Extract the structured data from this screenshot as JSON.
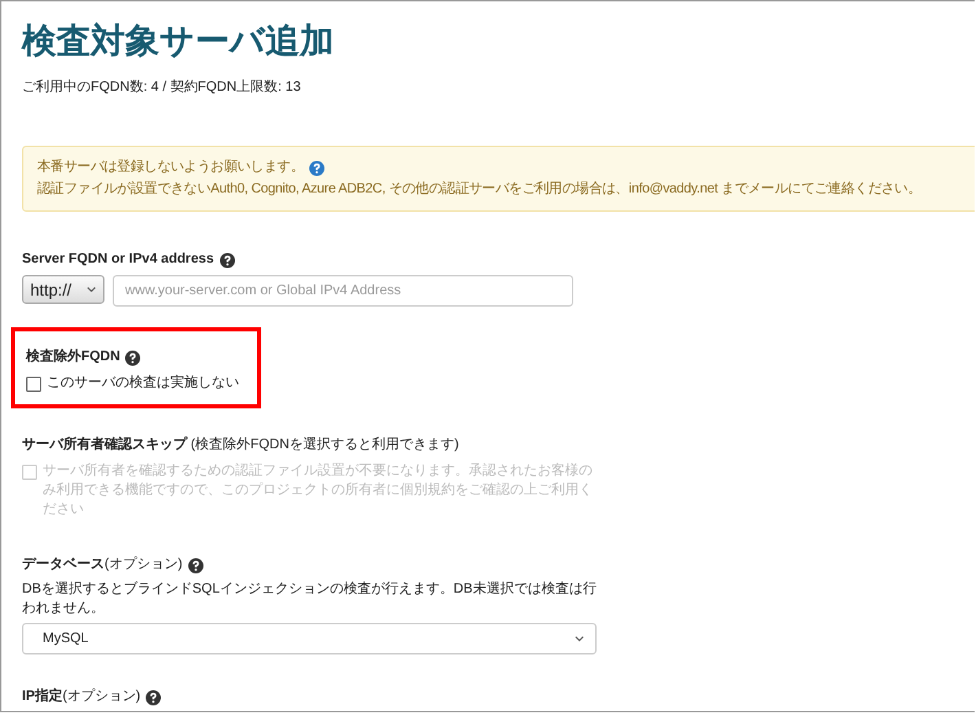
{
  "title": "検査対象サーバ追加",
  "usage": "ご利用中のFQDN数: 4 / 契約FQDN上限数: 13",
  "alert": {
    "lines": [
      "本番サーバは登録しないようお願いします。",
      "認証ファイルが設置できないAuth0, Cognito, Azure ADB2C, その他の認証サーバをご利用の場合は、info@vaddy.net までメールにてご連絡ください。"
    ]
  },
  "fields": [
    {
      "kind": "url",
      "label": "Server FQDN or IPv4 address",
      "help": true,
      "protocol": "http://",
      "placeholder": "www.your-server.com or Global IPv4 Address"
    },
    {
      "kind": "checkbox",
      "label": "検査除外FQDN",
      "help": true,
      "highlighted": true,
      "option": "このサーバの検査は実施しない",
      "checked": false,
      "disabled": false
    },
    {
      "kind": "checkbox",
      "label": "**サーバ所有者確認スキップ** (検査除外FQDNを選択すると利用できます)",
      "help": false,
      "highlighted": false,
      "option": "サーバ所有者を確認するための認証ファイル設置が不要になります。承認されたお客様のみ利用できる機能ですので、このプロジェクトの所有者に個別規約をご確認の上ご利用ください",
      "checked": false,
      "disabled": true
    },
    {
      "kind": "select",
      "label": "**データベース**(オプション)",
      "help": true,
      "description": "DBを選択するとブラインドSQLインジェクションの検査が行えます。DB未選択では検査は行われません。",
      "value": "MySQL"
    },
    {
      "kind": "heading",
      "label": "**IP指定**(オプション)",
      "help": true
    }
  ]
}
